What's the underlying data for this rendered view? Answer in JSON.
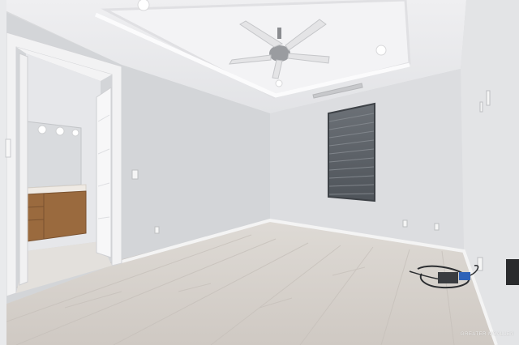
{
  "photo": {
    "watermark_text": "GREATER MCALLEN",
    "colors": {
      "wall_left": "#d4d6d9",
      "wall_back": "#dcdde0",
      "wall_right": "#e2e3e5",
      "ceiling": "#ececee",
      "floor": "#d7d3cf",
      "trim": "#f4f4f4",
      "cabinet": "#9a6a3e",
      "blind": "#5b6066"
    }
  }
}
